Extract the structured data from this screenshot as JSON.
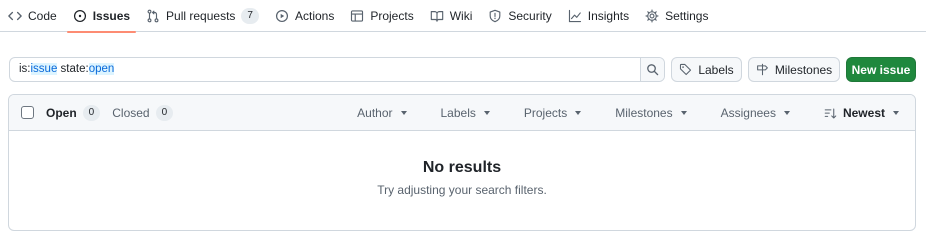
{
  "nav": {
    "items": [
      {
        "label": "Code",
        "icon": "code-icon"
      },
      {
        "label": "Issues",
        "icon": "issue-opened-icon",
        "selected": true
      },
      {
        "label": "Pull requests",
        "icon": "git-pull-request-icon",
        "count": "7"
      },
      {
        "label": "Actions",
        "icon": "play-icon"
      },
      {
        "label": "Projects",
        "icon": "table-icon"
      },
      {
        "label": "Wiki",
        "icon": "book-icon"
      },
      {
        "label": "Security",
        "icon": "shield-icon"
      },
      {
        "label": "Insights",
        "icon": "graph-icon"
      },
      {
        "label": "Settings",
        "icon": "gear-icon"
      }
    ]
  },
  "search": {
    "query_prefix_1": "is:",
    "query_hl_1": "issue",
    "query_prefix_2": " state:",
    "query_hl_2": "open"
  },
  "toolbar": {
    "labels_label": "Labels",
    "milestones_label": "Milestones",
    "new_issue_label": "New issue"
  },
  "list_header": {
    "open_label": "Open",
    "open_count": "0",
    "closed_label": "Closed",
    "closed_count": "0",
    "filters": [
      "Author",
      "Labels",
      "Projects",
      "Milestones",
      "Assignees"
    ],
    "sort_label": "Newest"
  },
  "empty_state": {
    "title": "No results",
    "hint": "Try adjusting your search filters."
  },
  "colors": {
    "accent_underline": "#fd8c73",
    "primary_button": "#1f883d",
    "highlight_bg": "#ddf4ff",
    "highlight_text": "#0969da"
  }
}
